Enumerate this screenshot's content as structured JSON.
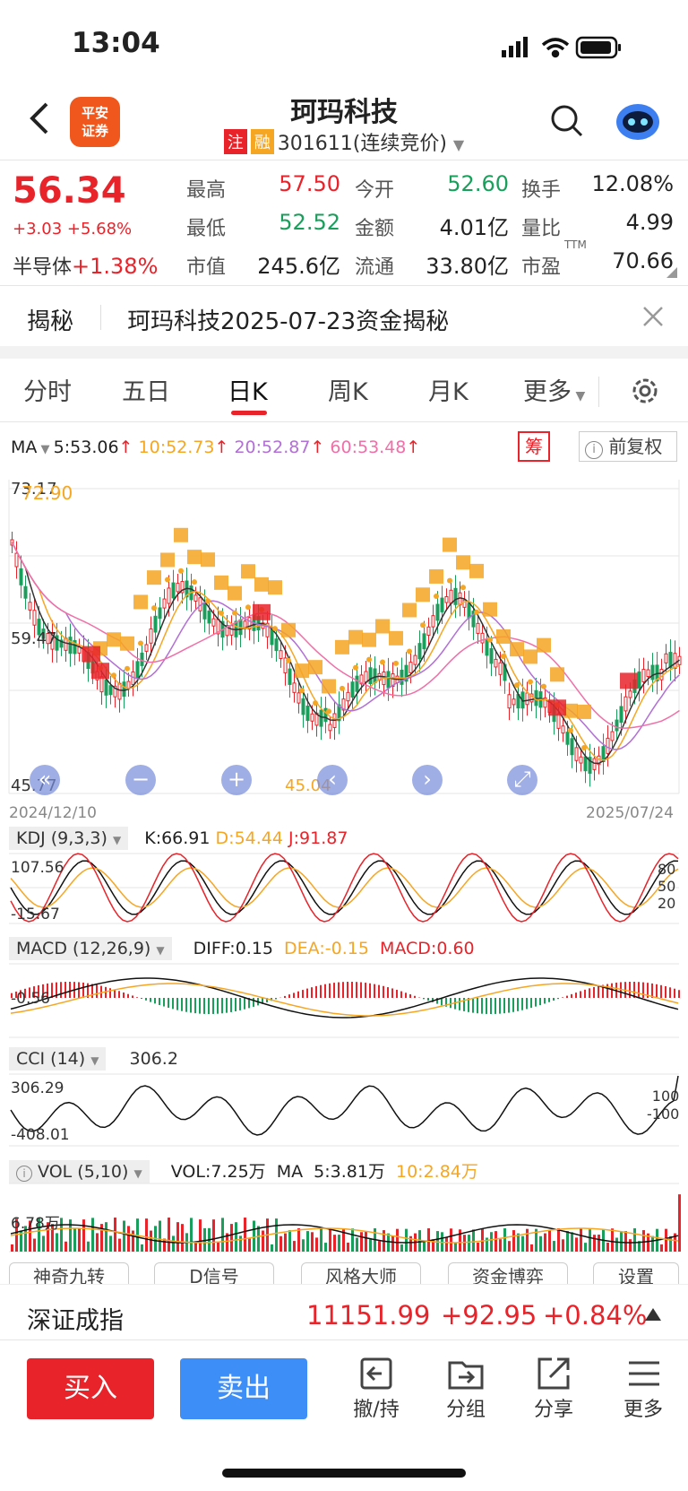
{
  "status": {
    "time": "13:04"
  },
  "header": {
    "title": "珂玛科技",
    "tag1": "注",
    "tag2": "融",
    "code": "301611(连续竞价)",
    "broker_line1": "平安",
    "broker_line2": "证券"
  },
  "quote": {
    "price": "56.34",
    "change": "+3.03 +5.68%",
    "sector_name": "半导体",
    "sector_change": "+1.38%",
    "cells": [
      {
        "label": "最高",
        "value": "57.50",
        "color": "red"
      },
      {
        "label": "今开",
        "value": "52.60",
        "color": "green"
      },
      {
        "label": "换手",
        "value": "12.08%",
        "color": "dark"
      },
      {
        "label": "最低",
        "value": "52.52",
        "color": "green"
      },
      {
        "label": "金额",
        "value": "4.01亿",
        "color": "dark"
      },
      {
        "label": "量比",
        "value": "4.99",
        "color": "dark"
      },
      {
        "label": "市值",
        "value": "245.6亿",
        "color": "dark"
      },
      {
        "label": "流通",
        "value": "33.80亿",
        "color": "dark"
      },
      {
        "label": "市盈",
        "value": "70.66",
        "color": "dark"
      }
    ],
    "pe_sup": "TTM"
  },
  "reveal": {
    "label": "揭秘",
    "text": "珂玛科技2025-07-23资金揭秘"
  },
  "tabs": [
    "分时",
    "五日",
    "日K",
    "周K",
    "月K",
    "更多"
  ],
  "active_tab": "日K",
  "ma_line": {
    "label": "MA",
    "ma5": "5:53.06",
    "ma10": "10:52.73",
    "ma20": "20:52.87",
    "ma60": "60:53.48",
    "chip_btn": "筹",
    "adjust_btn": "前复权"
  },
  "kchart": {
    "y_top": "73.17",
    "y_high_mark": "72.90",
    "y_mid": "59.47",
    "y_low": "45.77",
    "low_mark": "45.04",
    "date_start": "2024/12/10",
    "date_end": "2025/07/24",
    "buy_label": "买",
    "sell_label": "卖",
    "t_label": "T"
  },
  "kdj": {
    "title": "KDJ (9,3,3)",
    "k": "K:66.91",
    "d": "D:54.44",
    "j": "J:91.87",
    "y_top": "107.56",
    "y_low": "-15.67",
    "r1": "80",
    "r2": "50",
    "r3": "20"
  },
  "macd": {
    "title": "MACD (12,26,9)",
    "diff": "DIFF:0.15",
    "dea": "DEA:-0.15",
    "macd": "MACD:0.60",
    "y_mid": "-0.56"
  },
  "cci": {
    "title": "CCI (14)",
    "val": "306.2",
    "y_top": "306.29",
    "y_low": "-408.01",
    "r1": "100",
    "r2": "-100"
  },
  "vol": {
    "title": "VOL (5,10)",
    "vol": "VOL:7.25万",
    "ma_label": "MA",
    "ma5": "5:3.81万",
    "ma10": "10:2.84万",
    "y_mid": "6.78万"
  },
  "tools": [
    "神奇九转",
    "D信号",
    "风格大师",
    "资金博弈",
    "设置"
  ],
  "index": {
    "name": "深证成指",
    "value": "11151.99",
    "change": "+92.95",
    "pct": "+0.84%"
  },
  "actions": {
    "buy": "买入",
    "sell": "卖出",
    "b1": "撤/持",
    "b2": "分组",
    "b3": "分享",
    "b4": "更多"
  },
  "colors": {
    "red": "#e8232a",
    "green": "#1a9e5b",
    "blue": "#3d8ef7",
    "orange": "#f5a623",
    "purple": "#b26fd6",
    "pink": "#f06fa7"
  }
}
